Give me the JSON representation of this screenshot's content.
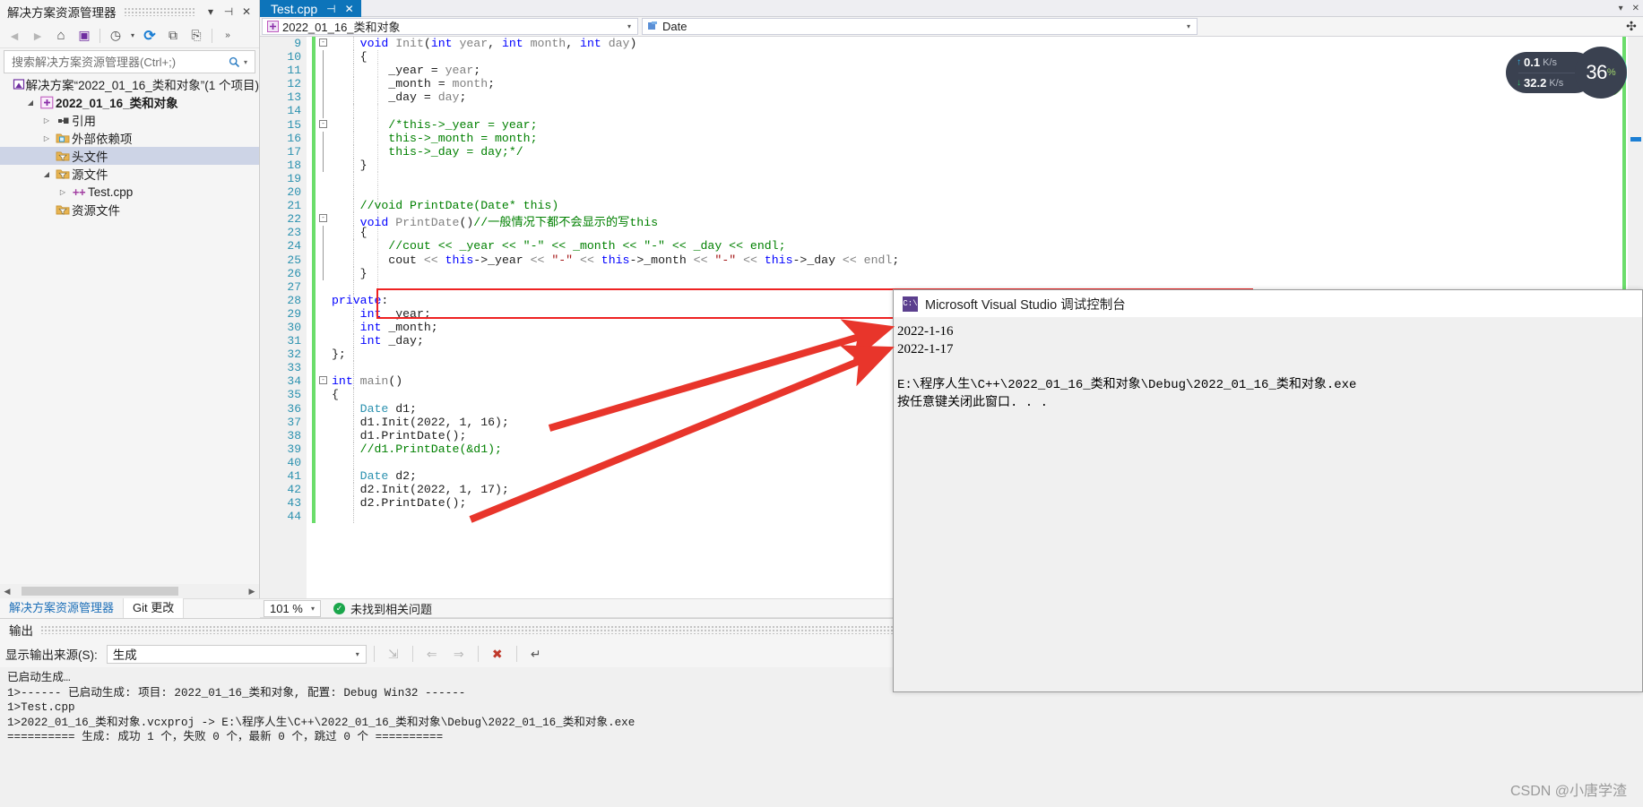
{
  "solution_explorer": {
    "title": "解决方案资源管理器",
    "title_buttons": [
      {
        "name": "dropdown",
        "glyph": "▾"
      },
      {
        "name": "pin",
        "glyph": "⊣"
      },
      {
        "name": "close",
        "glyph": "✕"
      }
    ],
    "toolbar": [
      {
        "name": "back-icon",
        "glyph": "◄"
      },
      {
        "name": "forward-icon",
        "glyph": "►"
      },
      {
        "name": "home-icon",
        "glyph": "⌂"
      },
      {
        "name": "solution-icon",
        "glyph": "▣"
      },
      {
        "name": "pending-changes-icon",
        "glyph": "◷"
      },
      {
        "name": "pending-changes-caret",
        "glyph": "▾"
      },
      {
        "name": "refresh-icon",
        "glyph": "⟳"
      },
      {
        "name": "collapse-all-icon",
        "glyph": "⧉"
      },
      {
        "name": "show-all-files-icon",
        "glyph": "⎘"
      },
      {
        "name": "overflow-icon",
        "glyph": "»"
      }
    ],
    "search_placeholder": "搜索解决方案资源管理器(Ctrl+;)",
    "search_value": "",
    "tree": [
      {
        "label": "解决方案“2022_01_16_类和对象”(1 个项目)",
        "indent": 0,
        "twisty": "",
        "icon": "solution-icon",
        "icon_color": "#6f2ea0",
        "bold": false,
        "selected": false
      },
      {
        "label": "2022_01_16_类和对象",
        "indent": 1,
        "twisty": "◢",
        "icon": "project-icon",
        "icon_color": "#c05cc0",
        "bold": true,
        "selected": false
      },
      {
        "label": "引用",
        "indent": 2,
        "twisty": "▷",
        "icon": "references-icon",
        "icon_color": "#444444",
        "bold": false,
        "selected": false
      },
      {
        "label": "外部依赖项",
        "indent": 2,
        "twisty": "▷",
        "icon": "external-deps-icon",
        "icon_color": "#d9a22e",
        "bold": false,
        "selected": false
      },
      {
        "label": "头文件",
        "indent": 2,
        "twisty": "",
        "icon": "filter-folder-icon",
        "icon_color": "#d9a22e",
        "bold": false,
        "selected": true
      },
      {
        "label": "源文件",
        "indent": 2,
        "twisty": "◢",
        "icon": "filter-folder-icon",
        "icon_color": "#d9a22e",
        "bold": false,
        "selected": false
      },
      {
        "label": "Test.cpp",
        "indent": 3,
        "twisty": "▷",
        "icon": "cpp-file-icon",
        "icon_color": "#a23fa2",
        "bold": false,
        "selected": false
      },
      {
        "label": "资源文件",
        "indent": 2,
        "twisty": "",
        "icon": "filter-folder-icon",
        "icon_color": "#d9a22e",
        "bold": false,
        "selected": false
      }
    ],
    "bottom_tabs": [
      {
        "label": "解决方案资源管理器",
        "active": true
      },
      {
        "label": "Git 更改",
        "active": false
      }
    ]
  },
  "editor": {
    "tab": {
      "label": "Test.cpp",
      "pin_glyph": "⊣",
      "close_glyph": "✕"
    },
    "tabstrip_right": [
      {
        "name": "tabstrip-dropdown-icon",
        "glyph": "▾"
      },
      {
        "name": "tabstrip-close-icon",
        "glyph": "✕"
      }
    ],
    "nav_scope": "2022_01_16_类和对象",
    "nav_member": "Date",
    "nav_split_glyph": "✣",
    "zoom": "101 %",
    "status_text": "未找到相关问题",
    "status_ok_glyph": "✓",
    "first_line_number": 9,
    "lines": [
      {
        "n": 9,
        "change": true,
        "fold": "-",
        "text": "    void Init(int year, int month, int day)",
        "tokens": [
          {
            "t": "    ",
            "c": "id"
          },
          {
            "t": "void",
            "c": "kw"
          },
          {
            "t": " ",
            "c": "id"
          },
          {
            "t": "Init",
            "c": "gy"
          },
          {
            "t": "(",
            "c": "id"
          },
          {
            "t": "int",
            "c": "kw"
          },
          {
            "t": " ",
            "c": "id"
          },
          {
            "t": "year",
            "c": "gy"
          },
          {
            "t": ", ",
            "c": "id"
          },
          {
            "t": "int",
            "c": "kw"
          },
          {
            "t": " ",
            "c": "id"
          },
          {
            "t": "month",
            "c": "gy"
          },
          {
            "t": ", ",
            "c": "id"
          },
          {
            "t": "int",
            "c": "kw"
          },
          {
            "t": " ",
            "c": "id"
          },
          {
            "t": "day",
            "c": "gy"
          },
          {
            "t": ")",
            "c": "id"
          }
        ]
      },
      {
        "n": 10,
        "change": true,
        "fold": "",
        "text": "    {",
        "tokens": [
          {
            "t": "    {",
            "c": "id"
          }
        ]
      },
      {
        "n": 11,
        "change": true,
        "fold": "",
        "text": "        _year = year;",
        "tokens": [
          {
            "t": "        _year ",
            "c": "id"
          },
          {
            "t": "= ",
            "c": "id"
          },
          {
            "t": "year",
            "c": "gy"
          },
          {
            "t": ";",
            "c": "id"
          }
        ]
      },
      {
        "n": 12,
        "change": true,
        "fold": "",
        "text": "        _month = month;",
        "tokens": [
          {
            "t": "        _month ",
            "c": "id"
          },
          {
            "t": "= ",
            "c": "id"
          },
          {
            "t": "month",
            "c": "gy"
          },
          {
            "t": ";",
            "c": "id"
          }
        ]
      },
      {
        "n": 13,
        "change": true,
        "fold": "",
        "text": "        _day = day;",
        "tokens": [
          {
            "t": "        _day ",
            "c": "id"
          },
          {
            "t": "= ",
            "c": "id"
          },
          {
            "t": "day",
            "c": "gy"
          },
          {
            "t": ";",
            "c": "id"
          }
        ]
      },
      {
        "n": 14,
        "change": true,
        "fold": "",
        "text": "",
        "tokens": []
      },
      {
        "n": 15,
        "change": true,
        "fold": "-",
        "text": "        /*this->_year = year;",
        "tokens": [
          {
            "t": "        /*this->_year = year;",
            "c": "cm"
          }
        ]
      },
      {
        "n": 16,
        "change": true,
        "fold": "",
        "text": "        this->_month = month;",
        "tokens": [
          {
            "t": "        this->_month = month;",
            "c": "cm"
          }
        ]
      },
      {
        "n": 17,
        "change": true,
        "fold": "",
        "text": "        this->_day = day;*/",
        "tokens": [
          {
            "t": "        this->_day = day;*/",
            "c": "cm"
          }
        ]
      },
      {
        "n": 18,
        "change": true,
        "fold": "",
        "text": "    }",
        "tokens": [
          {
            "t": "    }",
            "c": "id"
          }
        ]
      },
      {
        "n": 19,
        "change": true,
        "fold": "",
        "text": "",
        "tokens": []
      },
      {
        "n": 20,
        "change": true,
        "fold": "",
        "text": "",
        "tokens": []
      },
      {
        "n": 21,
        "change": true,
        "fold": "",
        "text": "    //void PrintDate(Date* this)",
        "tokens": [
          {
            "t": "    //void PrintDate(Date* this)",
            "c": "cm"
          }
        ]
      },
      {
        "n": 22,
        "change": true,
        "fold": "-",
        "text": "    void PrintDate()//一般情况下都不会显示的写this",
        "tokens": [
          {
            "t": "    ",
            "c": "id"
          },
          {
            "t": "void",
            "c": "kw"
          },
          {
            "t": " ",
            "c": "id"
          },
          {
            "t": "PrintDate",
            "c": "gy"
          },
          {
            "t": "()",
            "c": "id"
          },
          {
            "t": "//一般情况下都不会显示的写this",
            "c": "cm"
          }
        ]
      },
      {
        "n": 23,
        "change": true,
        "fold": "",
        "text": "    {",
        "tokens": [
          {
            "t": "    {",
            "c": "id"
          }
        ]
      },
      {
        "n": 24,
        "change": true,
        "fold": "",
        "text": "        //cout << _year << \"-\" << _month << \"-\" << _day << endl;",
        "tokens": [
          {
            "t": "        //cout << _year << \"-\" << _month << \"-\" << _day << endl;",
            "c": "cm"
          }
        ]
      },
      {
        "n": 25,
        "change": true,
        "fold": "",
        "text": "        cout << this->_year << \"-\" << this->_month << \"-\" << this->_day << endl;",
        "tokens": [
          {
            "t": "        cout ",
            "c": "id"
          },
          {
            "t": "<< ",
            "c": "gy"
          },
          {
            "t": "this",
            "c": "kw"
          },
          {
            "t": "->_year ",
            "c": "id"
          },
          {
            "t": "<< ",
            "c": "gy"
          },
          {
            "t": "\"-\"",
            "c": "st"
          },
          {
            "t": " ",
            "c": "id"
          },
          {
            "t": "<< ",
            "c": "gy"
          },
          {
            "t": "this",
            "c": "kw"
          },
          {
            "t": "->_month ",
            "c": "id"
          },
          {
            "t": "<< ",
            "c": "gy"
          },
          {
            "t": "\"-\"",
            "c": "st"
          },
          {
            "t": " ",
            "c": "id"
          },
          {
            "t": "<< ",
            "c": "gy"
          },
          {
            "t": "this",
            "c": "kw"
          },
          {
            "t": "->_day ",
            "c": "id"
          },
          {
            "t": "<< ",
            "c": "gy"
          },
          {
            "t": "endl",
            "c": "gy"
          },
          {
            "t": ";",
            "c": "id"
          }
        ]
      },
      {
        "n": 26,
        "change": true,
        "fold": "",
        "text": "    }",
        "tokens": [
          {
            "t": "    }",
            "c": "id"
          }
        ]
      },
      {
        "n": 27,
        "change": true,
        "fold": "",
        "text": "",
        "tokens": []
      },
      {
        "n": 28,
        "change": true,
        "fold": "",
        "text": "private:",
        "tokens": [
          {
            "t": "private",
            "c": "kw"
          },
          {
            "t": ":",
            "c": "id"
          }
        ]
      },
      {
        "n": 29,
        "change": true,
        "fold": "",
        "text": "    int _year;",
        "tokens": [
          {
            "t": "    ",
            "c": "id"
          },
          {
            "t": "int",
            "c": "kw"
          },
          {
            "t": " _year;",
            "c": "id"
          }
        ]
      },
      {
        "n": 30,
        "change": true,
        "fold": "",
        "text": "    int _month;",
        "tokens": [
          {
            "t": "    ",
            "c": "id"
          },
          {
            "t": "int",
            "c": "kw"
          },
          {
            "t": " _month;",
            "c": "id"
          }
        ]
      },
      {
        "n": 31,
        "change": true,
        "fold": "",
        "text": "    int _day;",
        "tokens": [
          {
            "t": "    ",
            "c": "id"
          },
          {
            "t": "int",
            "c": "kw"
          },
          {
            "t": " _day;",
            "c": "id"
          }
        ]
      },
      {
        "n": 32,
        "change": true,
        "fold": "",
        "text": "};",
        "tokens": [
          {
            "t": "};",
            "c": "id"
          }
        ]
      },
      {
        "n": 33,
        "change": true,
        "fold": "",
        "text": "",
        "tokens": []
      },
      {
        "n": 34,
        "change": true,
        "fold": "-",
        "text": "int main()",
        "tokens": [
          {
            "t": "int",
            "c": "kw"
          },
          {
            "t": " ",
            "c": "id"
          },
          {
            "t": "main",
            "c": "gy"
          },
          {
            "t": "()",
            "c": "id"
          }
        ]
      },
      {
        "n": 35,
        "change": true,
        "fold": "",
        "text": "{",
        "tokens": [
          {
            "t": "{",
            "c": "id"
          }
        ]
      },
      {
        "n": 36,
        "change": true,
        "fold": "",
        "text": "    Date d1;",
        "tokens": [
          {
            "t": "    ",
            "c": "id"
          },
          {
            "t": "Date",
            "c": "ty"
          },
          {
            "t": " d1;",
            "c": "id"
          }
        ]
      },
      {
        "n": 37,
        "change": true,
        "fold": "",
        "text": "    d1.Init(2022, 1, 16);",
        "tokens": [
          {
            "t": "    d1.Init(2022, 1, 16);",
            "c": "id"
          }
        ]
      },
      {
        "n": 38,
        "change": true,
        "fold": "",
        "text": "    d1.PrintDate();",
        "tokens": [
          {
            "t": "    d1.PrintDate();",
            "c": "id"
          }
        ]
      },
      {
        "n": 39,
        "change": true,
        "fold": "",
        "text": "    //d1.PrintDate(&d1);",
        "tokens": [
          {
            "t": "    //d1.PrintDate(&d1);",
            "c": "cm"
          }
        ]
      },
      {
        "n": 40,
        "change": true,
        "fold": "",
        "text": "",
        "tokens": []
      },
      {
        "n": 41,
        "change": true,
        "fold": "",
        "text": "    Date d2;",
        "tokens": [
          {
            "t": "    ",
            "c": "id"
          },
          {
            "t": "Date",
            "c": "ty"
          },
          {
            "t": " d2;",
            "c": "id"
          }
        ]
      },
      {
        "n": 42,
        "change": true,
        "fold": "",
        "text": "    d2.Init(2022, 1, 17);",
        "tokens": [
          {
            "t": "    d2.Init(2022, 1, 17);",
            "c": "id"
          }
        ]
      },
      {
        "n": 43,
        "change": true,
        "fold": "",
        "text": "    d2.PrintDate();",
        "tokens": [
          {
            "t": "    d2.PrintDate();",
            "c": "id"
          }
        ]
      },
      {
        "n": 44,
        "change": true,
        "fold": "",
        "text": "",
        "tokens": []
      }
    ]
  },
  "output": {
    "title": "输出",
    "source_label": "显示输出来源(S):",
    "source_value": "生成",
    "toolbar_icons": [
      {
        "name": "jump-to-icon",
        "glyph": "⇲"
      },
      {
        "name": "previous-message-icon",
        "glyph": "⇐"
      },
      {
        "name": "next-message-icon",
        "glyph": "⇒"
      },
      {
        "name": "clear-all-icon",
        "glyph": "✖"
      },
      {
        "name": "toggle-word-wrap-icon",
        "glyph": "↵"
      }
    ],
    "lines": [
      "已启动生成…",
      "1>------ 已启动生成: 项目: 2022_01_16_类和对象, 配置: Debug Win32 ------",
      "1>Test.cpp",
      "1>2022_01_16_类和对象.vcxproj -> E:\\程序人生\\C++\\2022_01_16_类和对象\\Debug\\2022_01_16_类和对象.exe",
      "========== 生成: 成功 1 个，失败 0 个，最新 0 个，跳过 0 个 =========="
    ]
  },
  "console_window": {
    "icon_label": "C:\\",
    "title": "Microsoft Visual Studio 调试控制台",
    "lines": [
      "2022-1-16",
      "2022-1-17",
      "",
      "E:\\程序人生\\C++\\2022_01_16_类和对象\\Debug\\2022_01_16_类和对象.exe",
      "按任意键关闭此窗口. . ."
    ]
  },
  "perf_widget": {
    "upload": {
      "value": "0.1",
      "unit": "K/s",
      "arrow": "↑"
    },
    "download": {
      "value": "32.2",
      "unit": "K/s",
      "arrow": "↓"
    },
    "cpu_percent": "36",
    "percent_symbol": "%"
  },
  "annotations": {
    "highlight_box_color": "#ee2222",
    "arrow_color": "#e8352b",
    "arrow_count": 2
  },
  "watermark": "CSDN @小唐学渣"
}
